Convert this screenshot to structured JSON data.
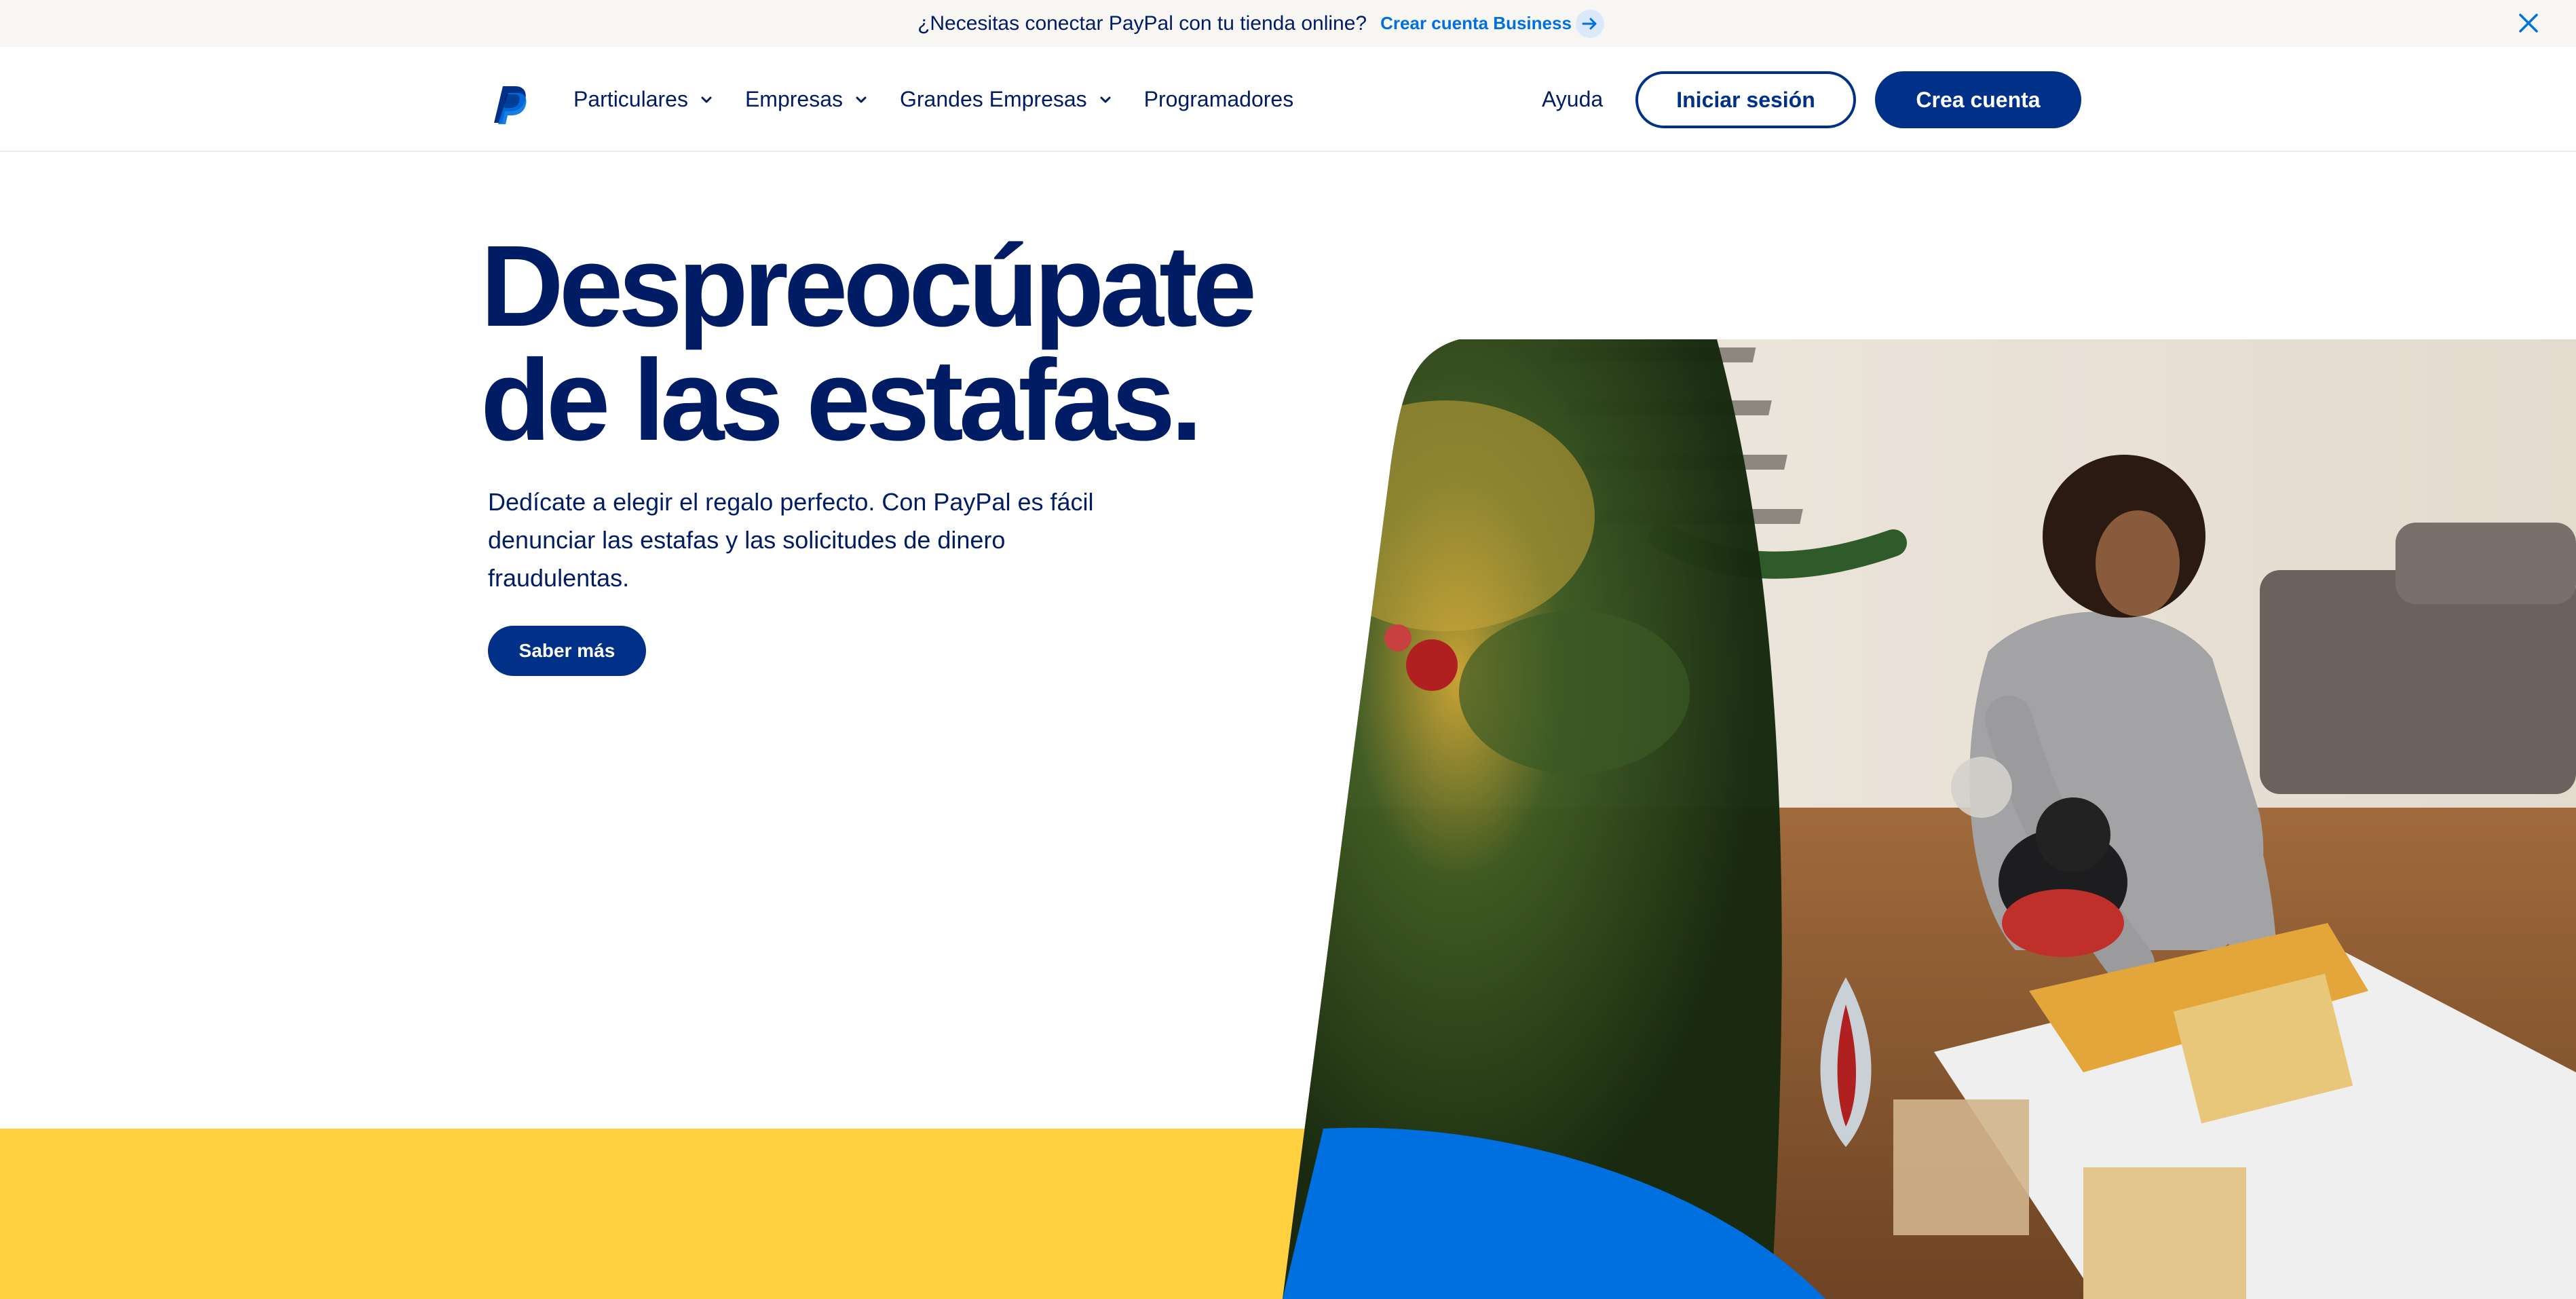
{
  "banner": {
    "text": "¿Necesitas conectar PayPal con tu tienda online?",
    "link_label": "Crear cuenta Business",
    "arrow_icon": "arrow-right-icon",
    "close_icon": "close-icon"
  },
  "header": {
    "logo_icon": "paypal-logo-icon",
    "nav": [
      {
        "label": "Particulares",
        "has_dropdown": true
      },
      {
        "label": "Empresas",
        "has_dropdown": true
      },
      {
        "label": "Grandes Empresas",
        "has_dropdown": true
      },
      {
        "label": "Programadores",
        "has_dropdown": false
      }
    ],
    "help_label": "Ayuda",
    "login_label": "Iniciar sesión",
    "signup_label": "Crea cuenta"
  },
  "hero": {
    "title_line1": "Despreocúpate",
    "title_line2": "de las estafas.",
    "body": "Dedícate a elegir el regalo perfecto. Con PayPal es fácil denunciar las estafas y las solicitudes de dinero fraudulentas.",
    "cta_label": "Saber más"
  },
  "colors": {
    "navy": "#001c64",
    "brand_blue": "#003087",
    "link_blue": "#0070e0",
    "yellow": "#ffd140",
    "bright_blue": "#0070e0",
    "banner_bg": "#f7f6f3"
  }
}
